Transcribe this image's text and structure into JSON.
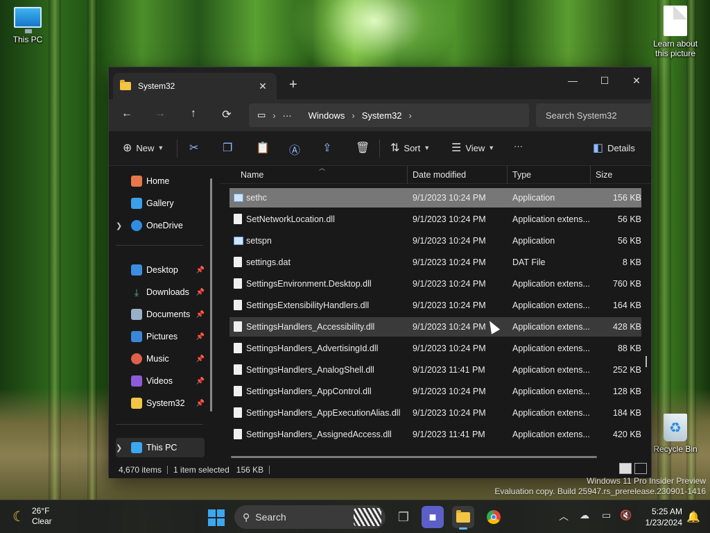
{
  "desktop": {
    "icons": [
      {
        "label": "This PC"
      },
      {
        "label": "Learn about this picture"
      },
      {
        "label": "Recycle Bin"
      }
    ],
    "watermark_line1": "Windows 11 Pro Insider Preview",
    "watermark_line2": "Evaluation copy. Build 25947.rs_prerelease.230901-1416"
  },
  "window": {
    "tab_title": "System32",
    "tab_close": "✕",
    "new_tab": "+",
    "controls": {
      "minimize": "—",
      "maximize": "☐",
      "close": "✕"
    },
    "nav": {
      "back": "←",
      "forward": "→",
      "up": "↑",
      "refresh": "⟳"
    },
    "breadcrumb": {
      "more": "···",
      "items": [
        "Windows",
        "System32"
      ]
    },
    "search_placeholder": "Search System32",
    "toolbar": {
      "new": "New",
      "sort": "Sort",
      "view": "View",
      "more": "···",
      "details": "Details"
    },
    "sidebar": {
      "items": [
        {
          "label": "Home",
          "icon": "home-icon"
        },
        {
          "label": "Gallery",
          "icon": "gallery-icon"
        },
        {
          "label": "OneDrive",
          "icon": "onedrive-icon"
        },
        {
          "label": "Desktop",
          "icon": "desktop-icon"
        },
        {
          "label": "Downloads",
          "icon": "download-icon"
        },
        {
          "label": "Documents",
          "icon": "documents-icon"
        },
        {
          "label": "Pictures",
          "icon": "pictures-icon"
        },
        {
          "label": "Music",
          "icon": "music-icon"
        },
        {
          "label": "Videos",
          "icon": "videos-icon"
        },
        {
          "label": "System32",
          "icon": "folder-icon"
        },
        {
          "label": "This PC",
          "icon": "this-pc-icon"
        }
      ]
    },
    "columns": {
      "name": "Name",
      "date": "Date modified",
      "type": "Type",
      "size": "Size"
    },
    "files": [
      {
        "name": "sethc",
        "date": "9/1/2023 10:24 PM",
        "type": "Application",
        "size": "156 KB",
        "kind": "app"
      },
      {
        "name": "SetNetworkLocation.dll",
        "date": "9/1/2023 10:24 PM",
        "type": "Application extens...",
        "size": "56 KB",
        "kind": "dll"
      },
      {
        "name": "setspn",
        "date": "9/1/2023 10:24 PM",
        "type": "Application",
        "size": "56 KB",
        "kind": "app"
      },
      {
        "name": "settings.dat",
        "date": "9/1/2023 10:24 PM",
        "type": "DAT File",
        "size": "8 KB",
        "kind": "file"
      },
      {
        "name": "SettingsEnvironment.Desktop.dll",
        "date": "9/1/2023 10:24 PM",
        "type": "Application extens...",
        "size": "760 KB",
        "kind": "dll"
      },
      {
        "name": "SettingsExtensibilityHandlers.dll",
        "date": "9/1/2023 10:24 PM",
        "type": "Application extens...",
        "size": "164 KB",
        "kind": "dll"
      },
      {
        "name": "SettingsHandlers_Accessibility.dll",
        "date": "9/1/2023 10:24 PM",
        "type": "Application extens...",
        "size": "428 KB",
        "kind": "dll"
      },
      {
        "name": "SettingsHandlers_AdvertisingId.dll",
        "date": "9/1/2023 10:24 PM",
        "type": "Application extens...",
        "size": "88 KB",
        "kind": "dll"
      },
      {
        "name": "SettingsHandlers_AnalogShell.dll",
        "date": "9/1/2023 11:41 PM",
        "type": "Application extens...",
        "size": "252 KB",
        "kind": "dll"
      },
      {
        "name": "SettingsHandlers_AppControl.dll",
        "date": "9/1/2023 10:24 PM",
        "type": "Application extens...",
        "size": "128 KB",
        "kind": "dll"
      },
      {
        "name": "SettingsHandlers_AppExecutionAlias.dll",
        "date": "9/1/2023 10:24 PM",
        "type": "Application extens...",
        "size": "184 KB",
        "kind": "dll"
      },
      {
        "name": "SettingsHandlers_AssignedAccess.dll",
        "date": "9/1/2023 11:41 PM",
        "type": "Application extens...",
        "size": "420 KB",
        "kind": "dll"
      }
    ],
    "status": {
      "count": "4,670 items",
      "selected": "1 item selected",
      "selected_size": "156 KB"
    }
  },
  "taskbar": {
    "weather_temp": "26°F",
    "weather_cond": "Clear",
    "search_label": "Search",
    "time": "5:25 AM",
    "date": "1/23/2024"
  },
  "colors": {
    "accent": "#3ba7f0",
    "folder": "#f3c544",
    "window_bg": "#191919"
  }
}
